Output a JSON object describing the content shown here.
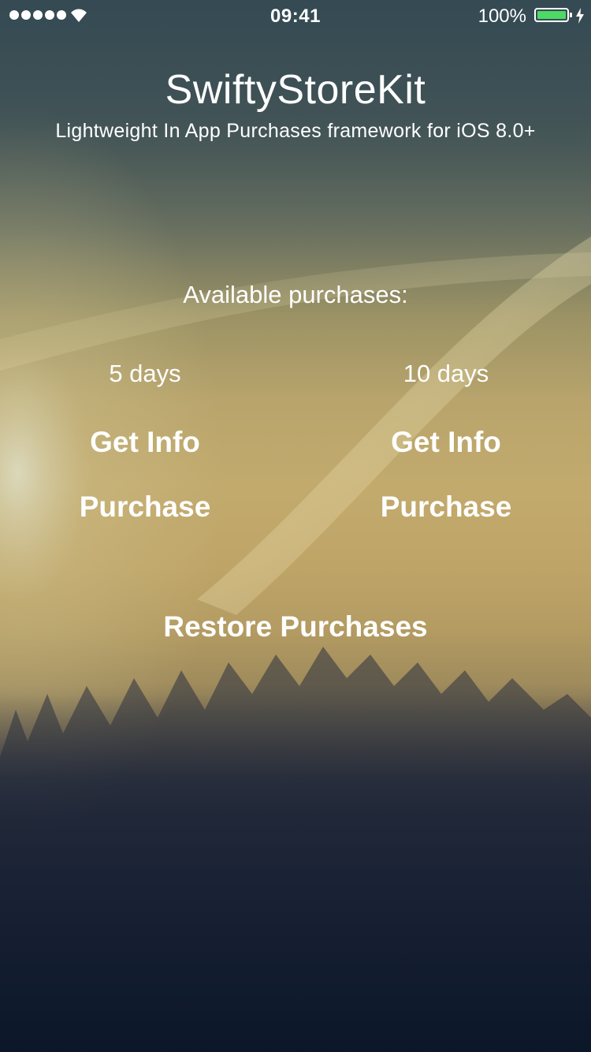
{
  "status_bar": {
    "time": "09:41",
    "battery_percent": "100%",
    "signal_icon": "signal-dots-icon",
    "wifi_icon": "wifi-icon",
    "battery_icon": "battery-icon",
    "charging_icon": "charging-bolt-icon",
    "battery_color": "#4cd964"
  },
  "header": {
    "title": "SwiftyStoreKit",
    "subtitle": "Lightweight In App Purchases framework for iOS 8.0+"
  },
  "purchases": {
    "section_label": "Available purchases:",
    "products": [
      {
        "name": "5 days",
        "info_label": "Get Info",
        "purchase_label": "Purchase"
      },
      {
        "name": "10 days",
        "info_label": "Get Info",
        "purchase_label": "Purchase"
      }
    ],
    "restore_label": "Restore Purchases"
  }
}
